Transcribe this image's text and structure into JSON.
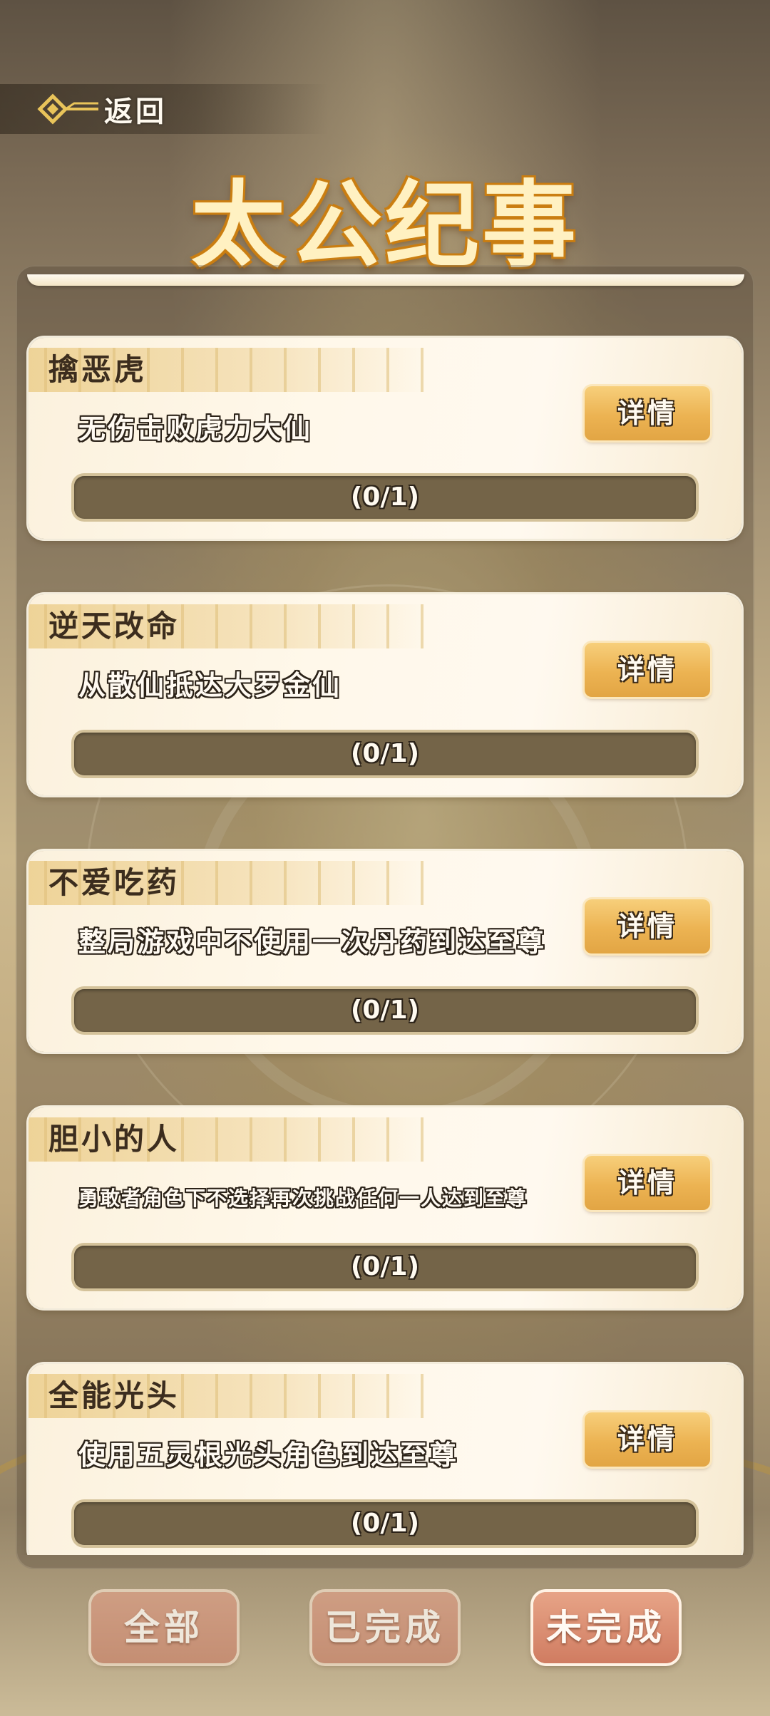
{
  "header": {
    "back_label": "返回",
    "title": "太公纪事"
  },
  "achievements": [
    {
      "title": "擒恶虎",
      "desc": "无伤击败虎力大仙",
      "detail_label": "详情",
      "progress_text": "(0/1)",
      "progress": 0
    },
    {
      "title": "逆天改命",
      "desc": "从散仙抵达大罗金仙",
      "detail_label": "详情",
      "progress_text": "(0/1)",
      "progress": 0
    },
    {
      "title": "不爱吃药",
      "desc": "整局游戏中不使用一次丹药到达至尊",
      "detail_label": "详情",
      "progress_text": "(0/1)",
      "progress": 0
    },
    {
      "title": "胆小的人",
      "desc": "勇敢者角色下不选择再次挑战任何一人达到至尊",
      "detail_label": "详情",
      "progress_text": "(0/1)",
      "progress": 0
    },
    {
      "title": "全能光头",
      "desc": "使用五灵根光头角色到达至尊",
      "detail_label": "详情",
      "progress_text": "(0/1)",
      "progress": 0
    }
  ],
  "filters": {
    "all": "全部",
    "completed": "已完成",
    "incomplete": "未完成",
    "active": "incomplete"
  }
}
